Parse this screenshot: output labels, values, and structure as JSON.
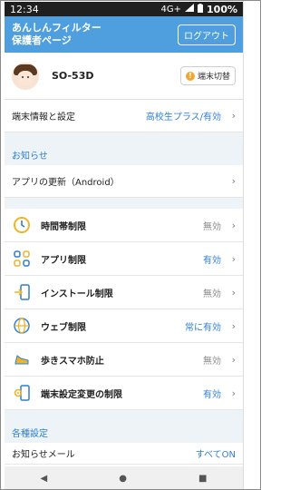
{
  "status_bar": {
    "time": "12:34",
    "network": "4G+",
    "battery": "100%"
  },
  "header": {
    "title_line1": "あんしんフィルター",
    "title_line2": "保護者ページ",
    "logout_label": "ログアウト"
  },
  "device": {
    "name": "SO-53D",
    "switch_label": "端末切替"
  },
  "settings_row": {
    "label": "端末情報と設定",
    "value": "高校生プラス/有効"
  },
  "notice": {
    "section_title": "お知らせ",
    "item_label": "アプリの更新（Android）"
  },
  "menu": [
    {
      "label": "時間帯制限",
      "value": "無効",
      "value_color": "#888888",
      "icon": "clock-icon"
    },
    {
      "label": "アプリ制限",
      "value": "有効",
      "value_color": "#2f7fd0",
      "icon": "apps-grid-icon"
    },
    {
      "label": "インストール制限",
      "value": "無効",
      "value_color": "#888888",
      "icon": "install-icon"
    },
    {
      "label": "ウェブ制限",
      "value": "常に有効",
      "value_color": "#2f7fd0",
      "icon": "globe-icon"
    },
    {
      "label": "歩きスマホ防止",
      "value": "無効",
      "value_color": "#888888",
      "icon": "shoe-icon"
    },
    {
      "label": "端末設定変更の制限",
      "value": "有効",
      "value_color": "#2f7fd0",
      "icon": "gear-phone-icon"
    }
  ],
  "other": {
    "section_title": "各種設定",
    "partial_label": "お知らせメール",
    "partial_value": "すべてON"
  },
  "colors": {
    "accent": "#4f9ede",
    "link": "#2f7fd0",
    "section_bg": "#eef3f8"
  }
}
